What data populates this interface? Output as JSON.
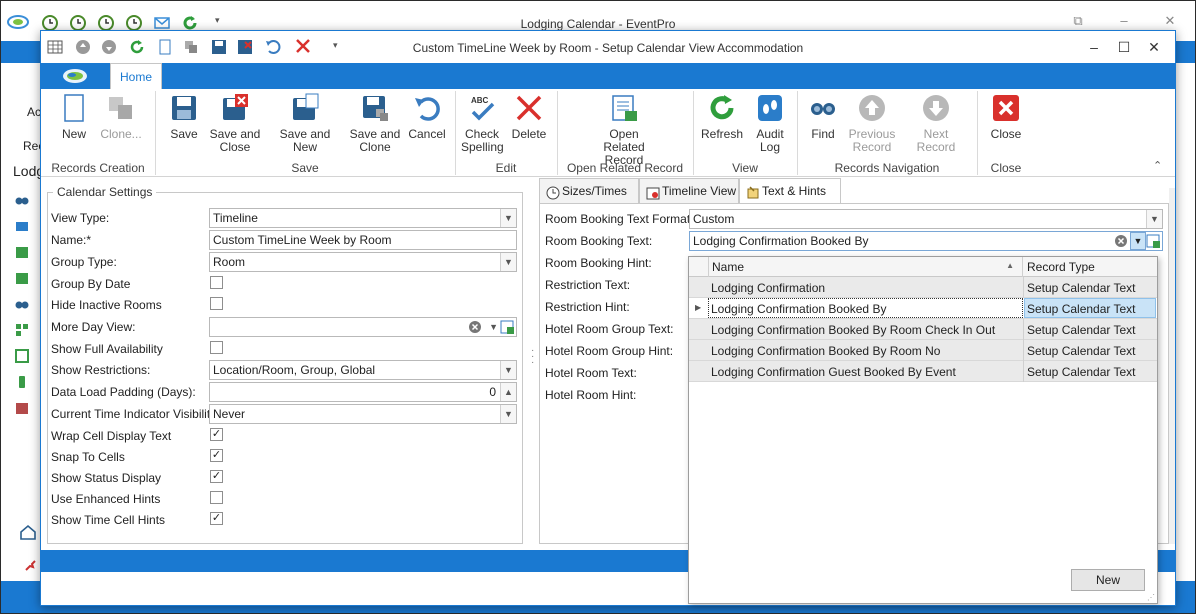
{
  "outer": {
    "title": "Lodging Calendar - EventPro",
    "left_texts": [
      "Ac",
      "Rec",
      "Lodg"
    ]
  },
  "window": {
    "title": "Custom TimeLine Week by Room - Setup Calendar View Accommodation",
    "home_tab": "Home"
  },
  "ribbon": {
    "buttons": {
      "new": "New",
      "clone": "Clone...",
      "save": "Save",
      "save_close": "Save and Close",
      "save_new": "Save and New",
      "save_clone": "Save and Clone",
      "cancel": "Cancel",
      "check_spelling": "Check Spelling",
      "delete": "Delete",
      "open_related": "Open Related Record",
      "refresh": "Refresh",
      "audit_log": "Audit Log",
      "find": "Find",
      "previous": "Previous Record",
      "next": "Next Record",
      "close": "Close"
    },
    "groups": {
      "records_creation": "Records Creation",
      "save": "Save",
      "edit": "Edit",
      "open_related": "Open Related Record",
      "view": "View",
      "navigation": "Records Navigation",
      "close": "Close"
    }
  },
  "calendar_settings": {
    "title": "Calendar Settings",
    "view_type_label": "View Type:",
    "view_type_value": "Timeline",
    "name_label": "Name:*",
    "name_value": "Custom TimeLine Week by Room",
    "group_type_label": "Group Type:",
    "group_type_value": "Room",
    "group_by_date_label": "Group By Date",
    "hide_inactive_label": "Hide Inactive Rooms",
    "more_day_label": "More Day View:",
    "more_day_value": "",
    "full_avail_label": "Show Full Availability",
    "restrictions_label": "Show Restrictions:",
    "restrictions_value": "Location/Room, Group, Global",
    "padding_label": "Data Load Padding (Days):",
    "padding_value": "0",
    "time_indicator_label": "Current Time Indicator Visibility:",
    "time_indicator_value": "Never",
    "wrap_label": "Wrap Cell Display Text",
    "snap_label": "Snap To Cells",
    "status_label": "Show Status Display",
    "enhanced_label": "Use Enhanced Hints",
    "time_hints_label": "Show Time Cell Hints",
    "checks": {
      "group_by_date": false,
      "hide_inactive": false,
      "full_avail": false,
      "wrap": true,
      "snap": true,
      "status": true,
      "enhanced": false,
      "time_hints": true
    }
  },
  "tabs": {
    "sizes": "Sizes/Times",
    "timeline": "Timeline View",
    "text_hints": "Text & Hints"
  },
  "text_hints": {
    "format_label": "Room Booking Text Format:",
    "format_value": "Custom",
    "text_label": "Room Booking Text:",
    "text_value": "Lodging Confirmation Booked By",
    "hint_label": "Room Booking Hint:",
    "restriction_text_label": "Restriction Text:",
    "restriction_hint_label": "Restriction Hint:",
    "hrg_text_label": "Hotel Room Group Text:",
    "hrg_hint_label": "Hotel Room Group Hint:",
    "hr_text_label": "Hotel Room Text:",
    "hr_hint_label": "Hotel Room Hint:"
  },
  "popup": {
    "col_name": "Name",
    "col_type": "Record Type",
    "rows": [
      {
        "name": "Lodging Confirmation",
        "type": "Setup Calendar Text"
      },
      {
        "name": "Lodging Confirmation Booked By",
        "type": "Setup Calendar Text"
      },
      {
        "name": "Lodging Confirmation Booked By Room Check In Out",
        "type": "Setup Calendar Text"
      },
      {
        "name": "Lodging Confirmation Booked By Room No",
        "type": "Setup Calendar Text"
      },
      {
        "name": "Lodging Confirmation Guest Booked By Event",
        "type": "Setup Calendar Text"
      }
    ],
    "selected_index": 1,
    "new_button": "New"
  },
  "colors": {
    "accent": "#1a79d1",
    "selection": "#c9e3f7",
    "close_red": "#d9302c",
    "refresh_green": "#2f9e3c"
  }
}
